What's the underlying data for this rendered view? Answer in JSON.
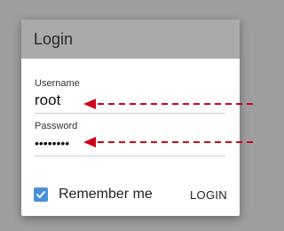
{
  "dialog": {
    "title": "Login",
    "username": {
      "label": "Username",
      "value": "root"
    },
    "password": {
      "label": "Password",
      "value": "••••••••"
    },
    "remember": {
      "label": "Remember me",
      "checked": true
    },
    "login_button": "LOGIN"
  },
  "colors": {
    "backdrop": "#9e9e9e",
    "header": "#a9a9a9",
    "checkbox": "#4a90d9",
    "arrow": "#d0021b"
  },
  "icons": [
    "check-icon"
  ]
}
